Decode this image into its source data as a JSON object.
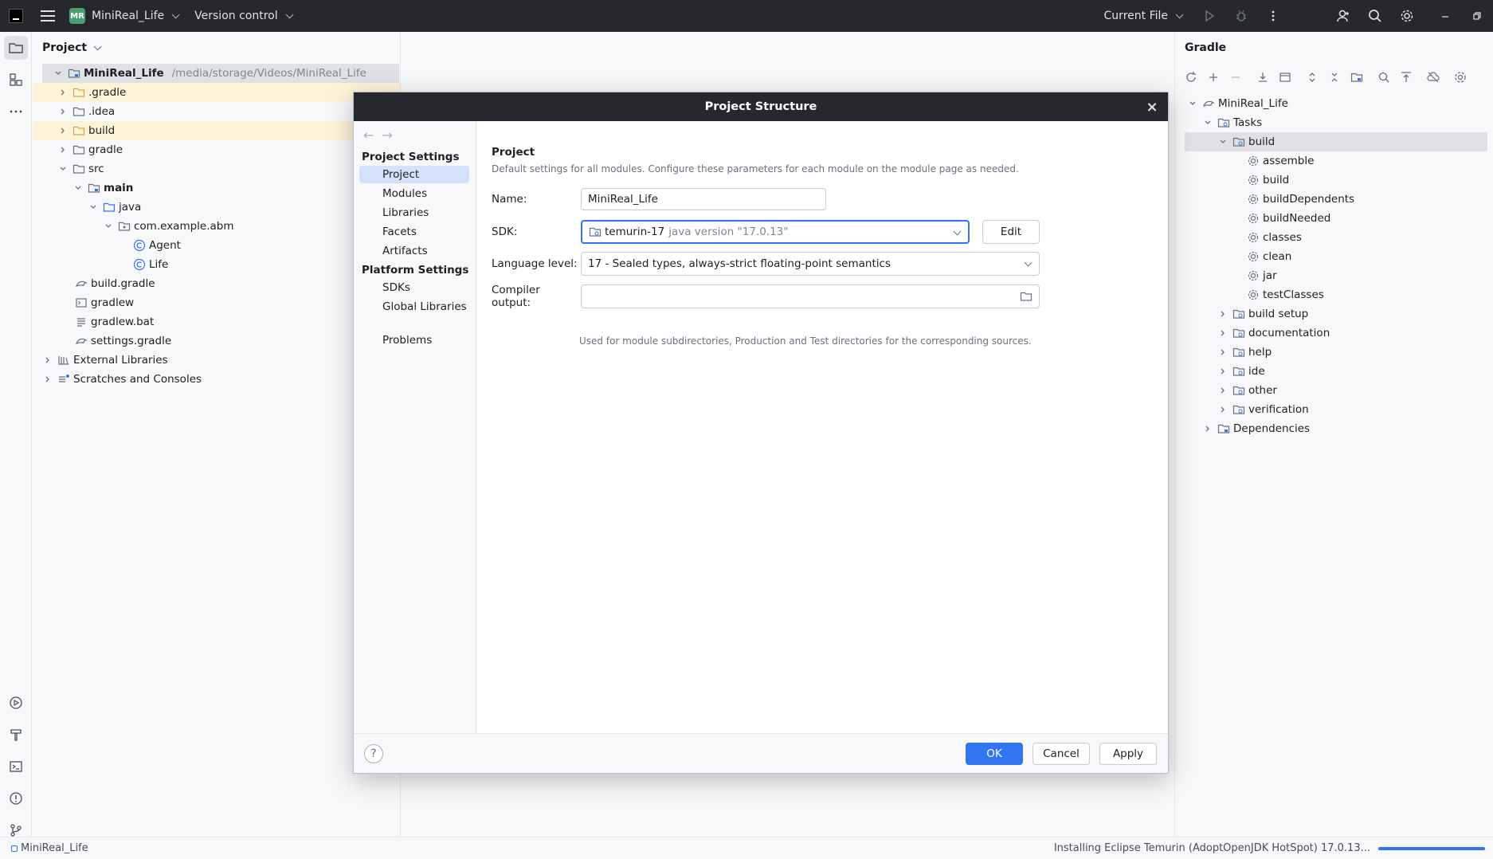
{
  "titlebar": {
    "badge": "MR",
    "project_name": "MiniReal_Life",
    "version_control": "Version control",
    "run_config": "Current File"
  },
  "project_panel": {
    "title": "Project",
    "tree": [
      {
        "label": "MiniReal_Life",
        "path": "/media/storage/Videos/MiniReal_Life"
      },
      {
        "label": ".gradle"
      },
      {
        "label": ".idea"
      },
      {
        "label": "build"
      },
      {
        "label": "gradle"
      },
      {
        "label": "src"
      },
      {
        "label": "main"
      },
      {
        "label": "java"
      },
      {
        "label": "com.example.abm"
      },
      {
        "label": "Agent"
      },
      {
        "label": "Life"
      },
      {
        "label": "build.gradle"
      },
      {
        "label": "gradlew"
      },
      {
        "label": "gradlew.bat"
      },
      {
        "label": "settings.gradle"
      },
      {
        "label": "External Libraries"
      },
      {
        "label": "Scratches and Consoles"
      }
    ]
  },
  "gradle_panel": {
    "title": "Gradle",
    "tree": [
      {
        "label": "MiniReal_Life"
      },
      {
        "label": "Tasks"
      },
      {
        "label": "build"
      },
      {
        "label": "assemble"
      },
      {
        "label": "build"
      },
      {
        "label": "buildDependents"
      },
      {
        "label": "buildNeeded"
      },
      {
        "label": "classes"
      },
      {
        "label": "clean"
      },
      {
        "label": "jar"
      },
      {
        "label": "testClasses"
      },
      {
        "label": "build setup"
      },
      {
        "label": "documentation"
      },
      {
        "label": "help"
      },
      {
        "label": "ide"
      },
      {
        "label": "other"
      },
      {
        "label": "verification"
      },
      {
        "label": "Dependencies"
      }
    ]
  },
  "dialog": {
    "title": "Project Structure",
    "sidebar": {
      "project_settings": "Project Settings",
      "items1": [
        "Project",
        "Modules",
        "Libraries",
        "Facets",
        "Artifacts"
      ],
      "platform_settings": "Platform Settings",
      "items2": [
        "SDKs",
        "Global Libraries"
      ],
      "problems": "Problems"
    },
    "content": {
      "section_title": "Project",
      "section_desc": "Default settings for all modules. Configure these parameters for each module on the module page as needed.",
      "name_label": "Name:",
      "name_value": "MiniReal_Life",
      "sdk_label": "SDK:",
      "sdk_name": "temurin-17",
      "sdk_version": "java version \"17.0.13\"",
      "edit_label": "Edit",
      "language_label": "Language level:",
      "language_value": "17 - Sealed types, always-strict floating-point semantics",
      "compiler_label": "Compiler output:",
      "compiler_value": "",
      "compiler_hint": "Used for module subdirectories, Production and Test directories for the corresponding sources."
    },
    "footer": {
      "help": "?",
      "ok": "OK",
      "cancel": "Cancel",
      "apply": "Apply"
    }
  },
  "statusbar": {
    "project": "MiniReal_Life",
    "task": "Installing Eclipse Temurin (AdoptOpenJDK HotSpot) 17.0.13...",
    "progress_fraction": 1.0
  },
  "colors": {
    "accent": "#3574f0",
    "titlebar_bg": "#27282e",
    "selection": "#d5e1fb",
    "excluded_highlight": "#fdf3d9"
  }
}
